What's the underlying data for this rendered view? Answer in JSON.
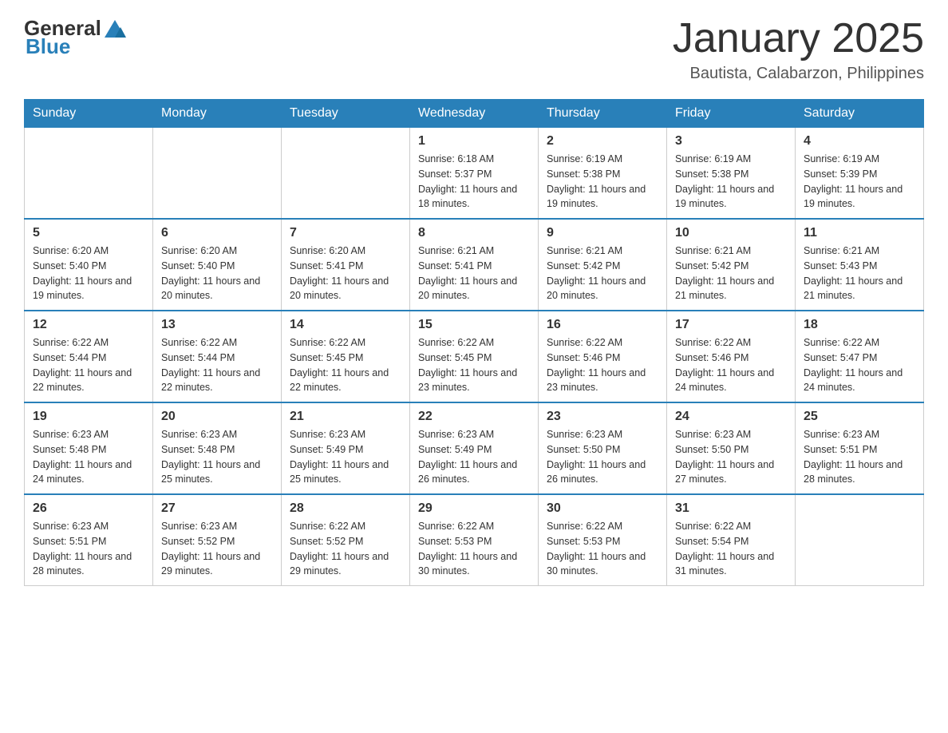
{
  "header": {
    "logo_text_general": "General",
    "logo_text_blue": "Blue",
    "month_title": "January 2025",
    "location": "Bautista, Calabarzon, Philippines"
  },
  "days_of_week": [
    "Sunday",
    "Monday",
    "Tuesday",
    "Wednesday",
    "Thursday",
    "Friday",
    "Saturday"
  ],
  "weeks": [
    {
      "days": [
        {
          "number": "",
          "info": ""
        },
        {
          "number": "",
          "info": ""
        },
        {
          "number": "",
          "info": ""
        },
        {
          "number": "1",
          "info": "Sunrise: 6:18 AM\nSunset: 5:37 PM\nDaylight: 11 hours and 18 minutes."
        },
        {
          "number": "2",
          "info": "Sunrise: 6:19 AM\nSunset: 5:38 PM\nDaylight: 11 hours and 19 minutes."
        },
        {
          "number": "3",
          "info": "Sunrise: 6:19 AM\nSunset: 5:38 PM\nDaylight: 11 hours and 19 minutes."
        },
        {
          "number": "4",
          "info": "Sunrise: 6:19 AM\nSunset: 5:39 PM\nDaylight: 11 hours and 19 minutes."
        }
      ]
    },
    {
      "days": [
        {
          "number": "5",
          "info": "Sunrise: 6:20 AM\nSunset: 5:40 PM\nDaylight: 11 hours and 19 minutes."
        },
        {
          "number": "6",
          "info": "Sunrise: 6:20 AM\nSunset: 5:40 PM\nDaylight: 11 hours and 20 minutes."
        },
        {
          "number": "7",
          "info": "Sunrise: 6:20 AM\nSunset: 5:41 PM\nDaylight: 11 hours and 20 minutes."
        },
        {
          "number": "8",
          "info": "Sunrise: 6:21 AM\nSunset: 5:41 PM\nDaylight: 11 hours and 20 minutes."
        },
        {
          "number": "9",
          "info": "Sunrise: 6:21 AM\nSunset: 5:42 PM\nDaylight: 11 hours and 20 minutes."
        },
        {
          "number": "10",
          "info": "Sunrise: 6:21 AM\nSunset: 5:42 PM\nDaylight: 11 hours and 21 minutes."
        },
        {
          "number": "11",
          "info": "Sunrise: 6:21 AM\nSunset: 5:43 PM\nDaylight: 11 hours and 21 minutes."
        }
      ]
    },
    {
      "days": [
        {
          "number": "12",
          "info": "Sunrise: 6:22 AM\nSunset: 5:44 PM\nDaylight: 11 hours and 22 minutes."
        },
        {
          "number": "13",
          "info": "Sunrise: 6:22 AM\nSunset: 5:44 PM\nDaylight: 11 hours and 22 minutes."
        },
        {
          "number": "14",
          "info": "Sunrise: 6:22 AM\nSunset: 5:45 PM\nDaylight: 11 hours and 22 minutes."
        },
        {
          "number": "15",
          "info": "Sunrise: 6:22 AM\nSunset: 5:45 PM\nDaylight: 11 hours and 23 minutes."
        },
        {
          "number": "16",
          "info": "Sunrise: 6:22 AM\nSunset: 5:46 PM\nDaylight: 11 hours and 23 minutes."
        },
        {
          "number": "17",
          "info": "Sunrise: 6:22 AM\nSunset: 5:46 PM\nDaylight: 11 hours and 24 minutes."
        },
        {
          "number": "18",
          "info": "Sunrise: 6:22 AM\nSunset: 5:47 PM\nDaylight: 11 hours and 24 minutes."
        }
      ]
    },
    {
      "days": [
        {
          "number": "19",
          "info": "Sunrise: 6:23 AM\nSunset: 5:48 PM\nDaylight: 11 hours and 24 minutes."
        },
        {
          "number": "20",
          "info": "Sunrise: 6:23 AM\nSunset: 5:48 PM\nDaylight: 11 hours and 25 minutes."
        },
        {
          "number": "21",
          "info": "Sunrise: 6:23 AM\nSunset: 5:49 PM\nDaylight: 11 hours and 25 minutes."
        },
        {
          "number": "22",
          "info": "Sunrise: 6:23 AM\nSunset: 5:49 PM\nDaylight: 11 hours and 26 minutes."
        },
        {
          "number": "23",
          "info": "Sunrise: 6:23 AM\nSunset: 5:50 PM\nDaylight: 11 hours and 26 minutes."
        },
        {
          "number": "24",
          "info": "Sunrise: 6:23 AM\nSunset: 5:50 PM\nDaylight: 11 hours and 27 minutes."
        },
        {
          "number": "25",
          "info": "Sunrise: 6:23 AM\nSunset: 5:51 PM\nDaylight: 11 hours and 28 minutes."
        }
      ]
    },
    {
      "days": [
        {
          "number": "26",
          "info": "Sunrise: 6:23 AM\nSunset: 5:51 PM\nDaylight: 11 hours and 28 minutes."
        },
        {
          "number": "27",
          "info": "Sunrise: 6:23 AM\nSunset: 5:52 PM\nDaylight: 11 hours and 29 minutes."
        },
        {
          "number": "28",
          "info": "Sunrise: 6:22 AM\nSunset: 5:52 PM\nDaylight: 11 hours and 29 minutes."
        },
        {
          "number": "29",
          "info": "Sunrise: 6:22 AM\nSunset: 5:53 PM\nDaylight: 11 hours and 30 minutes."
        },
        {
          "number": "30",
          "info": "Sunrise: 6:22 AM\nSunset: 5:53 PM\nDaylight: 11 hours and 30 minutes."
        },
        {
          "number": "31",
          "info": "Sunrise: 6:22 AM\nSunset: 5:54 PM\nDaylight: 11 hours and 31 minutes."
        },
        {
          "number": "",
          "info": ""
        }
      ]
    }
  ]
}
